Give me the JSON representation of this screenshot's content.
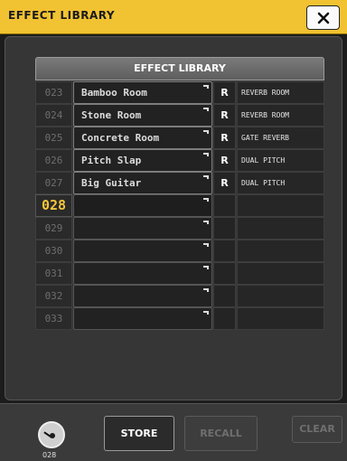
{
  "window": {
    "title": "EFFECT LIBRARY"
  },
  "library": {
    "header": "EFFECT LIBRARY",
    "rows": [
      {
        "number": "023",
        "name": "Bamboo Room",
        "readonly": "R",
        "type": "REVERB ROOM"
      },
      {
        "number": "024",
        "name": "Stone Room",
        "readonly": "R",
        "type": "REVERB ROOM"
      },
      {
        "number": "025",
        "name": "Concrete Room",
        "readonly": "R",
        "type": "GATE REVERB"
      },
      {
        "number": "026",
        "name": "Pitch Slap",
        "readonly": "R",
        "type": "DUAL PITCH"
      },
      {
        "number": "027",
        "name": "Big Guitar",
        "readonly": "R",
        "type": "DUAL PITCH"
      },
      {
        "number": "028",
        "name": "",
        "readonly": "",
        "type": "",
        "current": true
      },
      {
        "number": "029",
        "name": "",
        "readonly": "",
        "type": ""
      },
      {
        "number": "030",
        "name": "",
        "readonly": "",
        "type": ""
      },
      {
        "number": "031",
        "name": "",
        "readonly": "",
        "type": ""
      },
      {
        "number": "032",
        "name": "",
        "readonly": "",
        "type": ""
      },
      {
        "number": "033",
        "name": "",
        "readonly": "",
        "type": ""
      }
    ]
  },
  "controls": {
    "knob_value": "028",
    "store_label": "STORE",
    "recall_label": "RECALL",
    "clear_label": "CLEAR"
  },
  "colors": {
    "title_bar": "#f1c232",
    "current_number": "#f4c63a",
    "current_outline": "#e6c43a"
  },
  "icons": {
    "close": "close-icon",
    "edit": "edit-corner-icon",
    "knob": "rotary-knob-icon"
  }
}
